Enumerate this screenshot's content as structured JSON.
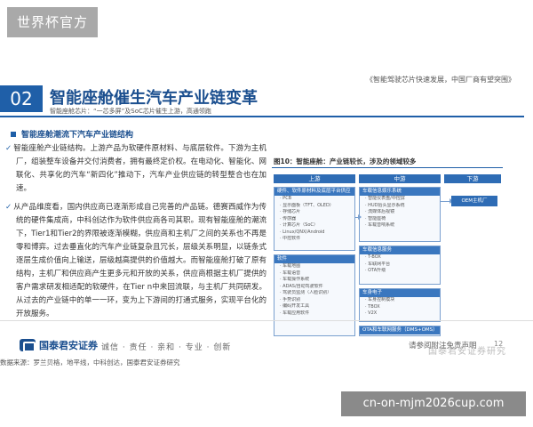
{
  "site_badge": "世界杯官方",
  "slide": {
    "deck_title": "《智能驾驶芯片快速发展，中国厂商有望突围》",
    "section_number": "02",
    "section_title": "智能座舱催生汽车产业链变革",
    "section_subtitle": "智能座舱芯片：“一芯多屏”及SoC芯片催生上游，高通领跑",
    "bullet_heading": "智能座舱潮流下汽车产业链结构",
    "para1": "智能座舱产业链结构。上游产品为软硬件原材料、与底层软件。下游为主机厂，组装整车设备并交付消费者，拥有最终定价权。在电动化、智能化、网联化、共享化的汽车“新四化”推动下，汽车产业供应链的转型整合也在加速。",
    "para2": "从产品维度看，国内供应商已逐渐形成自己完善的产品链。德赛西威作为传统的硬件集成商，中科创达作为软件供应商各司其职。现有智能座舱的潮流下，Tier1和Tier2的界限被逐渐模糊，供应商和主机厂之间的关系也不再是零和博弈。过去垂直化的汽车产业链复杂且冗长，层级关系明显，以链条式逐层生成价值向上输送，层级越高提供的价值越大。而智能座舱打破了原有结构，主机厂和供应商产生更多元和开放的关系，供应商根据主机厂提供的客户需求研发相适配的软硬件，在Tier n中来回流联，与主机厂共同研发。从过去的产业链中的单一一环，变为上下游间的打通式服务，实现平台化的开放服务。",
    "figure_caption": "图10：智能座舱：产业链较长，涉及的领域较多",
    "columns": {
      "upstream": "上游",
      "midstream": "中游",
      "downstream": "下游"
    },
    "boxes": {
      "b1": {
        "title": "硬件、软件原材料及底层平台供应",
        "lines": [
          "PCB",
          "显示面板（TFT、OLED）",
          "存储芯片",
          "传感器",
          "计算芯片（SoC）",
          "Linux/QNX/Android",
          "中控软件"
        ]
      },
      "b2": {
        "title": "软件",
        "lines": [
          "车载地图",
          "车载语音",
          "车载操作系统",
          "ADAS/自动驾驶软件",
          "驾驶员监测（人脸识别）",
          "手势识别",
          "编码开发工具",
          "车载应用软件"
        ]
      },
      "b3": {
        "title": "车载信息娱乐系统",
        "lines": [
          "智能仪表盘/中控屏",
          "HUD抬头显示系统",
          "流媒体后视镜",
          "智能座椅",
          "车载音响系统"
        ]
      },
      "b4": {
        "title": "车载信息服务",
        "lines": [
          "T-BOX",
          "车联网平台",
          "OTA升级"
        ]
      },
      "b5": {
        "title": "车身电子",
        "lines": [
          "车身控制模块",
          "TBOX",
          "V2X"
        ]
      },
      "b6": {
        "title": "OTA和车联网服务（DMS+OMS）",
        "lines": []
      }
    },
    "oem_label": "OEM主机厂",
    "company_name": "国泰君安证券",
    "slogan": "诚信 · 责任 · 亲和 · 专业 · 创新",
    "disclaimer": "请参阅附注免责声明",
    "page_number": "12",
    "watermark": "国泰君安证券研究",
    "source": "数据来源：罗兰贝格，地平线，中科创达，国泰君安证券研究"
  },
  "url_bar": "cn-on-mjm2026cup.com"
}
